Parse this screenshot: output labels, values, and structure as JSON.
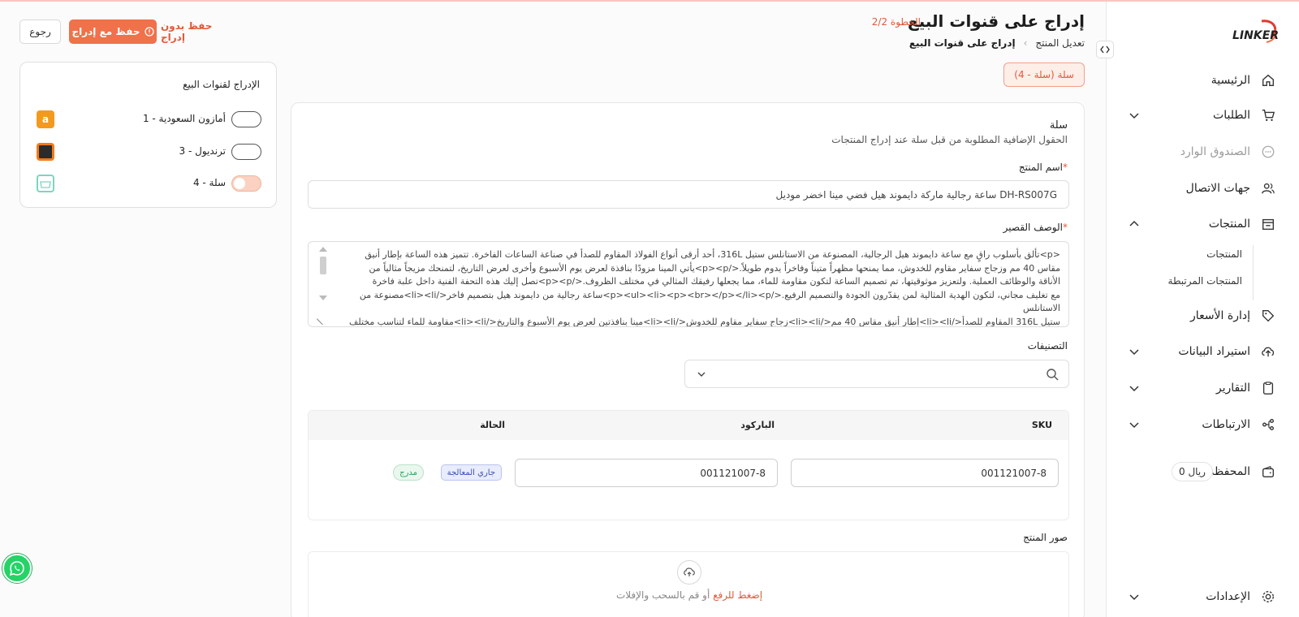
{
  "brand": {
    "logo_text": "LINKER",
    "accent": "#f0714a"
  },
  "sidebar": {
    "items": [
      {
        "label": "الرئيسية",
        "icon": "home-icon"
      },
      {
        "label": "الطلبات",
        "icon": "cart-icon"
      },
      {
        "label": "الصندوق الوارد",
        "icon": "chat-icon"
      },
      {
        "label": "جهات الاتصال",
        "icon": "users-icon"
      },
      {
        "label": "المنتجات",
        "icon": "store-icon"
      },
      {
        "label": "إدارة الأسعار",
        "icon": "tag-icon"
      },
      {
        "label": "استيراد البيانات",
        "icon": "cloud-upload-icon"
      },
      {
        "label": "التقارير",
        "icon": "clipboard-icon"
      },
      {
        "label": "الارتباطات",
        "icon": "share-icon"
      },
      {
        "label": "المحفظة",
        "icon": "wallet-icon"
      },
      {
        "label": "الإعدادات",
        "icon": "gear-icon"
      }
    ],
    "products_sub": [
      "المنتجات",
      "المنتجات المرتبطة"
    ],
    "wallet_balance": "0 ريال"
  },
  "header": {
    "title": "إدراج على قنوات البيع",
    "step": "الخطوة 2/2",
    "breadcrumb": [
      "تعديل المنتج",
      "إدراج على قنوات البيع"
    ],
    "back_label": "رجوع",
    "save_list_label": "حفظ مع إدراج",
    "save_only_label": "حفظ بدون إدراج",
    "channel_chip": "سلة (سلة - 4)"
  },
  "form": {
    "section_title": "سلة",
    "section_sub": "الحقول الإضافية المطلوبة من قبل سلة عند إدراج المنتجات",
    "name_label": "اسم المنتج",
    "name_value": "ساعة رجالية ماركة دايموند هيل فضي مينا اخضر موديل DH-RS007G",
    "desc_label": "الوصف القصير",
    "desc_lines": [
      "<p>تألق بأسلوب راقٍ مع ساعة دايموند هيل الرجالية، المصنوعة من الاستانلس ستيل 316L، أحد أرقى أنواع الفولاذ المقاوم للصدأ في صناعة الساعات الفاخرة. تتميز هذه الساعة بإطار أنيق",
      "مقاس 40 مم وزجاج سفاير مقاوم للخدوش، مما يمنحها مظهراً متيناً وفاخراً يدوم طويلاً.</p><p>يأتي المينا مزودًا بنافذة لعرض يوم الأسبوع وأخرى لعرض التاريخ، لتمنحك مزيجاً مثالياً من",
      "الأناقة والوظائف العملية. ولتعزيز موثوقيتها، تم تصميم الساعة لتكون مقاومة للماء، مما يجعلها رفيقك المثالي في مختلف الظروف.</p><p>تصل إليك هذه التحفة الفنية داخل علبة فاخرة",
      "مع تغليف مجاني، لتكون الهدية المثالية لمن يقدّرون الجودة والتصميم الرفيع.</p><ul><li><p><br></p></li><p>ساعة رجالية من دايموند هيل بتصميم فاخر</li><li>مصنوعة من الاستانلس",
      "ستيل 316L المقاوم للصدأ</li><li>إطار أنيق مقاس 40 مم</li><li>زجاج سفاير مقاوم للخدوش</li><li>مينا بنافذتين لعرض يوم الأسبوع والتاريخ</li><li>مقاومة للماء لتناسب مختلف"
    ],
    "categories_label": "التصنيفات",
    "images_label": "صور المنتج",
    "upload_link": "إضغط للرفع",
    "upload_rest": "أو قم بالسحب والإفلات"
  },
  "variants": {
    "headers": {
      "sku": "SKU",
      "barcode": "الباركود",
      "status": "الحالة"
    },
    "rows": [
      {
        "sku": "001121007-8",
        "barcode": "001121007-8",
        "status_processing": "جاري المعالجة",
        "status_listed": "مدرج"
      }
    ]
  },
  "channels": {
    "title": "الإدراج لقنوات البيع",
    "items": [
      {
        "name": "أمازون السعودية - 1",
        "logo": "a",
        "enabled": false,
        "color": "#f39a1e"
      },
      {
        "name": "ترنديول - 3",
        "logo": "trendyol",
        "enabled": false,
        "color": "#f27a1a"
      },
      {
        "name": "سلة - 4",
        "logo": "salla",
        "enabled": true,
        "color": "#7fd3c0"
      }
    ]
  }
}
